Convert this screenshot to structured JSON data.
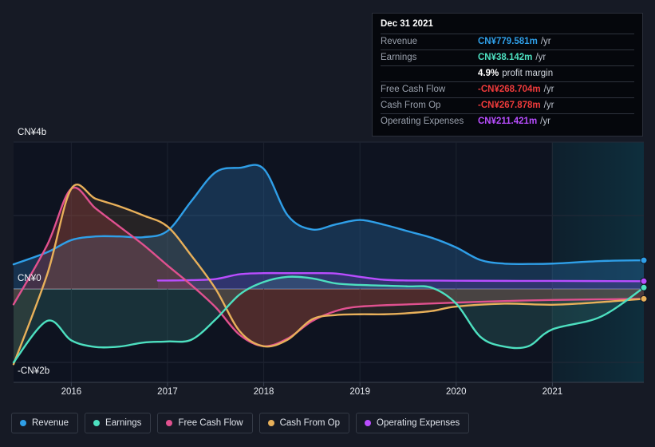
{
  "tooltip": {
    "date": "Dec 31 2021",
    "rows": [
      {
        "name": "Revenue",
        "value": "CN¥779.581m",
        "unit": "/yr",
        "color": "#2f9fe8"
      },
      {
        "name": "Earnings",
        "value": "CN¥38.142m",
        "unit": "/yr",
        "color": "#4de0c0"
      },
      {
        "name": "",
        "value": "4.9%",
        "unit": "",
        "sub": "profit margin",
        "color": "#ffffff"
      },
      {
        "name": "Free Cash Flow",
        "value": "-CN¥268.704m",
        "unit": "/yr",
        "color": "#ef3b3b"
      },
      {
        "name": "Cash From Op",
        "value": "-CN¥267.878m",
        "unit": "/yr",
        "color": "#ef3b3b"
      },
      {
        "name": "Operating Expenses",
        "value": "CN¥211.421m",
        "unit": "/yr",
        "color": "#b94dff"
      }
    ]
  },
  "legend": [
    {
      "label": "Revenue",
      "color": "#2f9fe8"
    },
    {
      "label": "Earnings",
      "color": "#4de0c0"
    },
    {
      "label": "Free Cash Flow",
      "color": "#e0518f"
    },
    {
      "label": "Cash From Op",
      "color": "#e8b05a"
    },
    {
      "label": "Operating Expenses",
      "color": "#b94dff"
    }
  ],
  "chart_data": {
    "type": "line",
    "title": "",
    "xlabel": "",
    "ylabel": "",
    "currency": "CNY",
    "y_axis": {
      "ticks": [
        "CN¥4b",
        "CN¥0",
        "-CN¥2b"
      ],
      "tick_values": [
        4000,
        0,
        -2000
      ],
      "gridline_values": [
        4000,
        2000,
        0,
        -2000
      ],
      "ylim": [
        -2000,
        4000
      ],
      "units": "CN¥ millions"
    },
    "x_axis": {
      "tick_labels": [
        "2016",
        "2017",
        "2018",
        "2019",
        "2020",
        "2021"
      ],
      "xlim": [
        "2015.4",
        "2021.95"
      ],
      "grid": true
    },
    "highlight_region": {
      "from": "2021",
      "to": "2021.95",
      "label": "selected period"
    },
    "series": [
      {
        "name": "Revenue",
        "color": "#2f9fe8",
        "fill": "rgba(41,110,168,0.35)",
        "x": [
          2015.4,
          2015.75,
          2016.0,
          2016.25,
          2016.5,
          2016.75,
          2017.0,
          2017.25,
          2017.5,
          2017.75,
          2018.0,
          2018.25,
          2018.5,
          2018.75,
          2019.0,
          2019.25,
          2019.5,
          2019.75,
          2020.0,
          2020.25,
          2020.5,
          2020.75,
          2021.0,
          2021.5,
          2021.95
        ],
        "values": [
          670,
          1000,
          1330,
          1430,
          1430,
          1410,
          1580,
          2400,
          3180,
          3300,
          3270,
          2000,
          1620,
          1760,
          1880,
          1750,
          1570,
          1390,
          1130,
          790,
          690,
          680,
          690,
          760,
          780
        ],
        "last_value": 779.581,
        "endpoint": true
      },
      {
        "name": "Earnings",
        "color": "#4de0c0",
        "fill": "rgba(60,140,130,0.25)",
        "x": [
          2015.4,
          2015.75,
          2016.0,
          2016.25,
          2016.5,
          2016.75,
          2017.0,
          2017.25,
          2017.5,
          2017.75,
          2018.0,
          2018.25,
          2018.5,
          2018.75,
          2019.0,
          2019.25,
          2019.5,
          2019.75,
          2020.0,
          2020.25,
          2020.5,
          2020.75,
          2021.0,
          2021.5,
          2021.95
        ],
        "values": [
          -2000,
          -870,
          -1400,
          -1580,
          -1570,
          -1460,
          -1430,
          -1380,
          -830,
          -150,
          190,
          330,
          290,
          150,
          110,
          90,
          70,
          30,
          -400,
          -1300,
          -1570,
          -1560,
          -1100,
          -760,
          38
        ],
        "last_value": 38.142,
        "endpoint": true
      },
      {
        "name": "Free Cash Flow",
        "color": "#e0518f",
        "fill": "rgba(150,50,60,0.35)",
        "x": [
          2015.4,
          2015.75,
          2016.0,
          2016.25,
          2016.5,
          2016.75,
          2017.0,
          2017.25,
          2017.5,
          2017.75,
          2018.0,
          2018.25,
          2018.5,
          2018.75,
          2019.0,
          2019.5,
          2020.0,
          2020.5,
          2021.0,
          2021.95
        ],
        "values": [
          -420,
          1200,
          2730,
          2200,
          1700,
          1200,
          640,
          100,
          -500,
          -1250,
          -1560,
          -1350,
          -880,
          -600,
          -480,
          -420,
          -370,
          -330,
          -300,
          -269
        ],
        "last_value": -268.704,
        "endpoint": false
      },
      {
        "name": "Cash From Op",
        "color": "#e8b05a",
        "fill": "rgba(150,110,60,0.18)",
        "x": [
          2015.4,
          2015.75,
          2016.0,
          2016.25,
          2016.5,
          2016.75,
          2017.0,
          2017.25,
          2017.5,
          2017.75,
          2018.0,
          2018.25,
          2018.5,
          2018.75,
          2019.0,
          2019.25,
          2019.5,
          2019.75,
          2020.0,
          2020.5,
          2021.0,
          2021.5,
          2021.95
        ],
        "values": [
          -2050,
          400,
          2730,
          2460,
          2250,
          2000,
          1700,
          900,
          0,
          -1150,
          -1560,
          -1380,
          -830,
          -710,
          -690,
          -690,
          -660,
          -600,
          -480,
          -400,
          -430,
          -360,
          -268
        ],
        "last_value": -267.878,
        "endpoint": true
      },
      {
        "name": "Operating Expenses",
        "color": "#b94dff",
        "fill": "rgba(90,55,160,0.38)",
        "x": [
          2016.9,
          2017.0,
          2017.25,
          2017.5,
          2017.75,
          2018.0,
          2018.25,
          2018.5,
          2018.75,
          2019.0,
          2019.25,
          2019.5,
          2020.0,
          2020.5,
          2021.0,
          2021.95
        ],
        "values": [
          230,
          230,
          240,
          270,
          400,
          430,
          430,
          430,
          420,
          330,
          250,
          230,
          225,
          220,
          218,
          211
        ],
        "last_value": 211.421,
        "endpoint": true
      }
    ]
  }
}
